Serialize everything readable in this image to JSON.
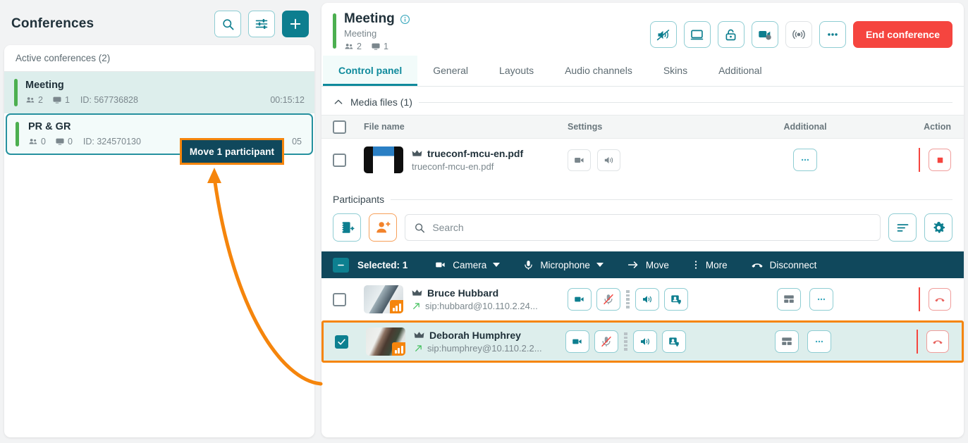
{
  "left_panel": {
    "title": "Conferences",
    "buttons": [
      {
        "name": "search-icon",
        "label": "Search"
      },
      {
        "name": "filter-icon",
        "label": "Filters"
      },
      {
        "name": "plus-icon",
        "label": "Create conference"
      }
    ],
    "list_header": "Active conferences (2)",
    "conferences": [
      {
        "name": "Meeting",
        "participants": "2",
        "streams": "1",
        "id": "ID: 567736828",
        "duration": "00:15:12",
        "state": "active"
      },
      {
        "name": "PR & GR",
        "participants": "0",
        "streams": "0",
        "id": "ID: 324570130",
        "duration": "05",
        "state": "selected"
      }
    ]
  },
  "annotation": {
    "tooltip_text": "Move 1 participant",
    "accent_color": "#f5850c"
  },
  "meeting": {
    "title": "Meeting",
    "subtitle": "Meeting",
    "participants": "2",
    "streams": "1",
    "info_icon": "info-icon",
    "actions": [
      {
        "name": "mute-all-speakers-icon"
      },
      {
        "name": "screen-icon"
      },
      {
        "name": "lock-icon"
      },
      {
        "name": "record-video-icon"
      },
      {
        "name": "streaming-icon"
      },
      {
        "name": "more-icon"
      }
    ],
    "end_button": "End conference",
    "tabs": [
      {
        "label": "Control panel",
        "active": true
      },
      {
        "label": "General",
        "active": false
      },
      {
        "label": "Layouts",
        "active": false
      },
      {
        "label": "Audio channels",
        "active": false
      },
      {
        "label": "Skins",
        "active": false
      },
      {
        "label": "Additional",
        "active": false
      }
    ]
  },
  "media_files": {
    "section_label": "Media files (1)",
    "columns": {
      "file_name": "File name",
      "settings": "Settings",
      "additional": "Additional",
      "action": "Action"
    },
    "rows": [
      {
        "checked": false,
        "name": "trueconf-mcu-en.pdf",
        "sub": "trueconf-mcu-en.pdf",
        "owner_icon": "crown-icon",
        "settings": [
          "video-icon",
          "audio-icon"
        ],
        "additional": "more-icon",
        "action": "stop-icon"
      }
    ]
  },
  "participants": {
    "section_label": "Participants",
    "tool_buttons": [
      {
        "name": "address-book-add-icon"
      },
      {
        "name": "invite-user-icon"
      }
    ],
    "search_placeholder": "Search",
    "search_value": "",
    "right_buttons": [
      {
        "name": "sort-icon"
      },
      {
        "name": "settings-gear-icon"
      }
    ],
    "selection_bar": {
      "count_label": "Selected: 1",
      "items": [
        {
          "label": "Camera",
          "icon": "camera-icon",
          "dropdown": true
        },
        {
          "label": "Microphone",
          "icon": "microphone-icon",
          "dropdown": true
        },
        {
          "label": "Move",
          "icon": "arrow-right-icon",
          "dropdown": false
        },
        {
          "label": "More",
          "icon": "kebab-icon",
          "dropdown": false
        },
        {
          "label": "Disconnect",
          "icon": "hangup-icon",
          "dropdown": false
        }
      ]
    },
    "rows": [
      {
        "checked": false,
        "selected": false,
        "name": "Bruce Hubbard",
        "sip": "sip:hubbard@10.110.2.24...",
        "owner_icon": "crown-icon",
        "direction_icon": "outgoing-arrow-icon",
        "controls": [
          "camera-icon",
          "microphone-muted-icon",
          "speaker-icon",
          "user-video-icon"
        ],
        "additional": [
          "layout-icon",
          "more-icon"
        ],
        "action": "hangup-icon"
      },
      {
        "checked": true,
        "selected": true,
        "name": "Deborah Humphrey",
        "sip": "sip:humphrey@10.110.2.2...",
        "owner_icon": "crown-icon",
        "direction_icon": "outgoing-arrow-icon",
        "controls": [
          "camera-icon",
          "microphone-muted-icon",
          "speaker-icon",
          "user-video-icon"
        ],
        "additional": [
          "layout-icon",
          "more-icon"
        ],
        "action": "hangup-icon"
      }
    ]
  },
  "colors": {
    "teal": "#0d8090",
    "dark": "#10485c",
    "red": "#f5453f",
    "orange": "#f5850c",
    "green": "#4caf50"
  }
}
